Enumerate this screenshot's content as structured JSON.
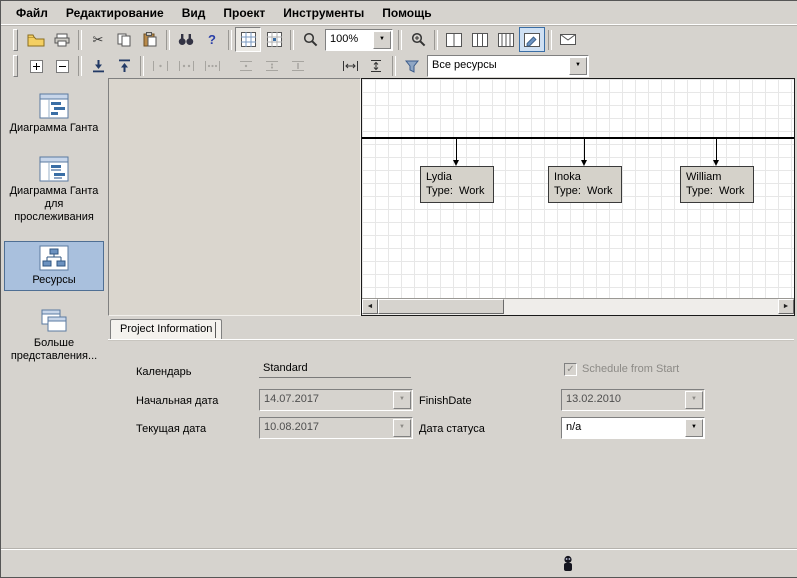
{
  "menu": {
    "items": [
      "Файл",
      "Редактирование",
      "Вид",
      "Проект",
      "Инструменты",
      "Помощь"
    ]
  },
  "toolbar": {
    "zoom_value": "100%"
  },
  "filter": {
    "value": "Все ресурсы"
  },
  "sidebar": {
    "items": [
      "Диаграмма Ганта",
      "Диаграмма Ганта для прослеживания",
      "Ресурсы",
      "Больше представления..."
    ]
  },
  "resources": [
    {
      "name": "Lydia",
      "type": "Type:  Work"
    },
    {
      "name": "Inoka",
      "type": "Type:  Work"
    },
    {
      "name": "William",
      "type": "Type:  Work"
    }
  ],
  "project_info": {
    "tab": "Project Information",
    "calendar_label": "Календарь",
    "calendar_value": "Standard",
    "start_label": "Начальная дата",
    "start_value": "14.07.2017",
    "current_label": "Текущая дата",
    "current_value": "10.08.2017",
    "finish_label": "FinishDate",
    "finish_value": "13.02.2010",
    "status_label": "Дата статуса",
    "status_value": "n/a",
    "schedule_checkbox_label": "Schedule from Start",
    "schedule_checked": true
  },
  "glyphs": {
    "cut": "✂",
    "help": "?",
    "dropdown": "▼",
    "scroll_left": "◄",
    "scroll_right": "►",
    "check": "✓"
  },
  "colors": {
    "window_bg": "#d6d3ce",
    "selection_bg": "#a9c0dd",
    "selection_border": "#4f6f94",
    "panel_white": "#ffffff",
    "grid_line": "#e7e7e7",
    "accent_blue": "#3a6ea5"
  }
}
